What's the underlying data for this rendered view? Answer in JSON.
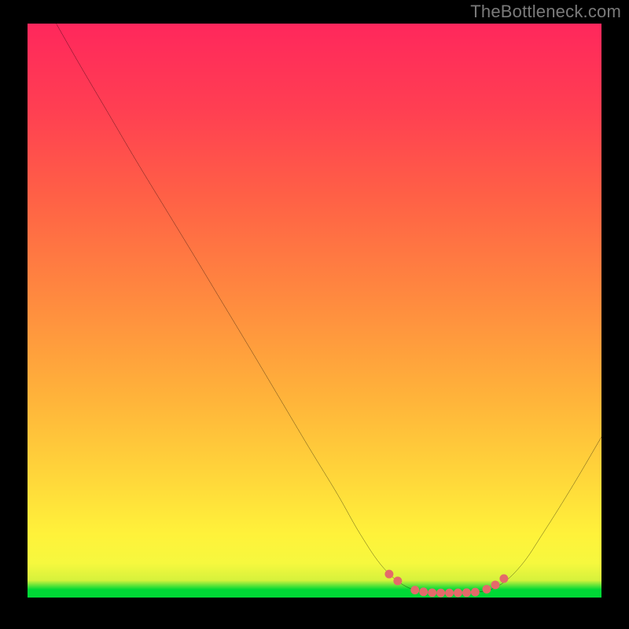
{
  "watermark": "TheBottleneck.com",
  "chart_data": {
    "type": "line",
    "title": "",
    "xlabel": "",
    "ylabel": "",
    "xlim": [
      0,
      100
    ],
    "ylim": [
      0,
      100
    ],
    "gradient_stops": [
      {
        "pos": 0,
        "color": "#00d936"
      },
      {
        "pos": 1.4,
        "color": "#00d936"
      },
      {
        "pos": 3,
        "color": "#d6f23c"
      },
      {
        "pos": 6,
        "color": "#f6f83e"
      },
      {
        "pos": 11,
        "color": "#fff23a"
      },
      {
        "pos": 20,
        "color": "#ffd93a"
      },
      {
        "pos": 34,
        "color": "#ffb53a"
      },
      {
        "pos": 52,
        "color": "#ff8a3f"
      },
      {
        "pos": 70,
        "color": "#ff6046"
      },
      {
        "pos": 85,
        "color": "#ff3f52"
      },
      {
        "pos": 100,
        "color": "#ff275c"
      }
    ],
    "series": [
      {
        "name": "bottleneck-curve",
        "color": "#000000",
        "points": [
          {
            "x": 5,
            "y": 100
          },
          {
            "x": 9,
            "y": 93
          },
          {
            "x": 14,
            "y": 84.5
          },
          {
            "x": 19,
            "y": 76
          },
          {
            "x": 24,
            "y": 67.8
          },
          {
            "x": 29,
            "y": 59.6
          },
          {
            "x": 34,
            "y": 51.3
          },
          {
            "x": 39,
            "y": 43
          },
          {
            "x": 44,
            "y": 34.6
          },
          {
            "x": 49,
            "y": 26.2
          },
          {
            "x": 54,
            "y": 18
          },
          {
            "x": 58,
            "y": 11
          },
          {
            "x": 62,
            "y": 5.2
          },
          {
            "x": 66,
            "y": 1.9
          },
          {
            "x": 70,
            "y": 0.9
          },
          {
            "x": 74,
            "y": 0.8
          },
          {
            "x": 78,
            "y": 0.9
          },
          {
            "x": 82,
            "y": 2
          },
          {
            "x": 86,
            "y": 5.6
          },
          {
            "x": 90,
            "y": 11.5
          },
          {
            "x": 95,
            "y": 19.5
          },
          {
            "x": 100,
            "y": 28
          }
        ]
      },
      {
        "name": "optimal-range-markers",
        "color": "#e46a6a",
        "type": "scatter",
        "points": [
          {
            "x": 63,
            "y": 4.1
          },
          {
            "x": 64.5,
            "y": 2.9
          },
          {
            "x": 67.5,
            "y": 1.3
          },
          {
            "x": 69,
            "y": 1.0
          },
          {
            "x": 70.5,
            "y": 0.85
          },
          {
            "x": 72,
            "y": 0.8
          },
          {
            "x": 73.5,
            "y": 0.8
          },
          {
            "x": 75,
            "y": 0.82
          },
          {
            "x": 76.5,
            "y": 0.86
          },
          {
            "x": 78,
            "y": 0.95
          },
          {
            "x": 80,
            "y": 1.45
          },
          {
            "x": 81.5,
            "y": 2.2
          },
          {
            "x": 83,
            "y": 3.3
          }
        ]
      }
    ]
  }
}
